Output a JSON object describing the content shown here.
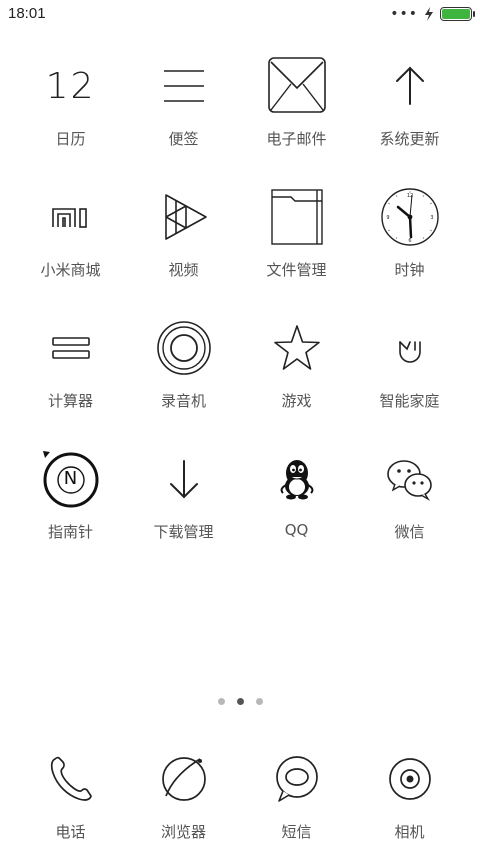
{
  "status_bar": {
    "time": "18:01",
    "battery_level": 1.0,
    "battery_color": "#3fb53f"
  },
  "apps": [
    {
      "label": "日历",
      "icon": "calendar-icon",
      "date_text": "12"
    },
    {
      "label": "便签",
      "icon": "notes-icon"
    },
    {
      "label": "电子邮件",
      "icon": "email-icon"
    },
    {
      "label": "系统更新",
      "icon": "update-icon"
    },
    {
      "label": "小米商城",
      "icon": "mi-store-icon"
    },
    {
      "label": "视频",
      "icon": "video-icon"
    },
    {
      "label": "文件管理",
      "icon": "folder-icon"
    },
    {
      "label": "时钟",
      "icon": "clock-icon"
    },
    {
      "label": "计算器",
      "icon": "calculator-icon"
    },
    {
      "label": "录音机",
      "icon": "recorder-icon"
    },
    {
      "label": "游戏",
      "icon": "star-icon"
    },
    {
      "label": "智能家庭",
      "icon": "smart-home-icon"
    },
    {
      "label": "指南针",
      "icon": "compass-icon",
      "compass_letter": "N"
    },
    {
      "label": "下载管理",
      "icon": "download-icon"
    },
    {
      "label": "QQ",
      "icon": "qq-icon"
    },
    {
      "label": "微信",
      "icon": "wechat-icon"
    }
  ],
  "pager": {
    "pages": 3,
    "active_index": 1
  },
  "dock": [
    {
      "label": "电话",
      "icon": "phone-icon"
    },
    {
      "label": "浏览器",
      "icon": "browser-icon"
    },
    {
      "label": "短信",
      "icon": "sms-icon"
    },
    {
      "label": "相机",
      "icon": "camera-icon"
    }
  ],
  "accent_color": "#3fb53f"
}
